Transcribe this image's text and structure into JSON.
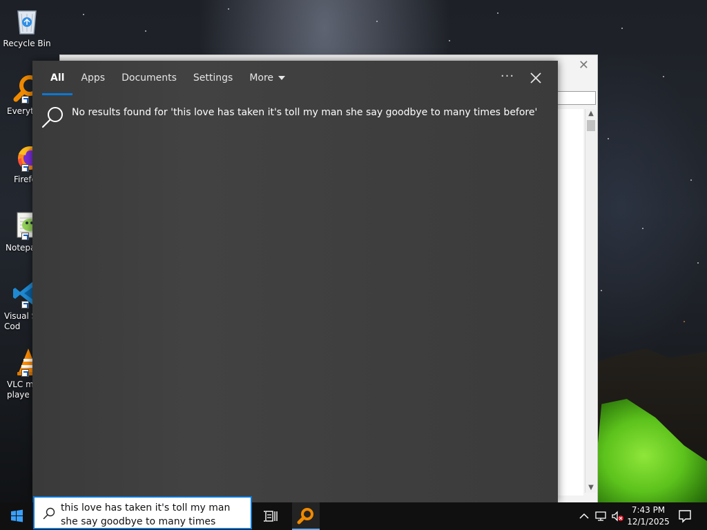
{
  "desktop_icons": [
    {
      "label": "Recycle Bin",
      "icon": "recycle-bin-icon"
    },
    {
      "label": "Everyth",
      "icon": "everything-search-icon"
    },
    {
      "label": "Firefo",
      "icon": "firefox-icon"
    },
    {
      "label": "Notepa",
      "icon": "notepad-plus-plus-icon"
    },
    {
      "label": "Visual St\nCod",
      "icon": "vscode-icon"
    },
    {
      "label": "VLC me\nplaye",
      "icon": "vlc-icon"
    }
  ],
  "search_panel": {
    "tabs": [
      {
        "label": "All",
        "active": true
      },
      {
        "label": "Apps",
        "active": false
      },
      {
        "label": "Documents",
        "active": false
      },
      {
        "label": "Settings",
        "active": false
      },
      {
        "label": "More",
        "active": false,
        "dropdown": true
      }
    ],
    "more_options_label": "···",
    "no_results_text": "No results found for 'this love has taken it's toll my man she say goodbye to many times before'"
  },
  "taskbar": {
    "search_query": "this love has taken it's toll my man she say goodbye to many times before",
    "clock_time": "7:43 PM",
    "clock_date": "12/1/2025"
  },
  "colors": {
    "accent": "#0a78d7",
    "panel_bg": "#3f3f3f",
    "taskbar_bg": "#101010",
    "everything_orange": "#f08a00"
  }
}
